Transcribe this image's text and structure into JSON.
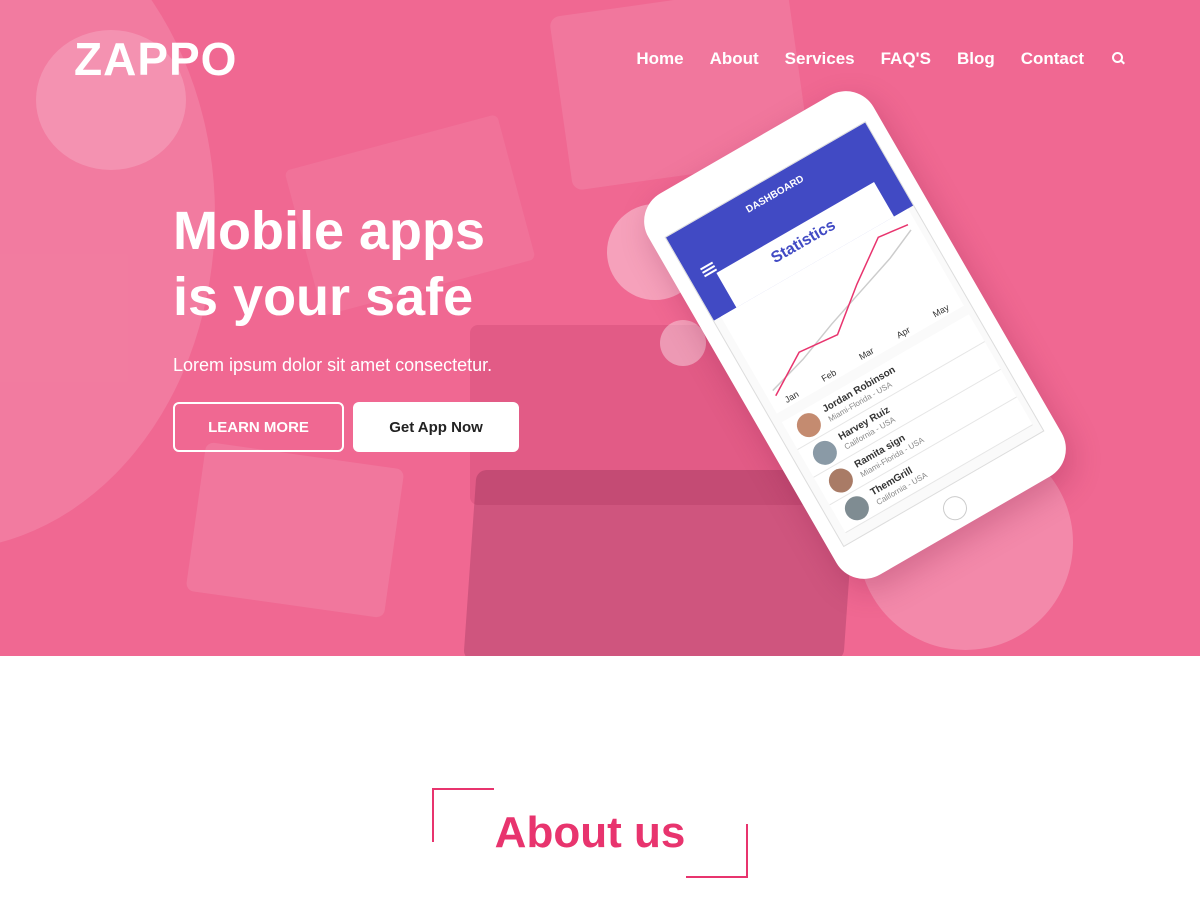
{
  "brand": {
    "logo": "ZAPPO",
    "accent": "#e8346e",
    "hero_bg": "#f06892"
  },
  "nav": {
    "items": [
      "Home",
      "About",
      "Services",
      "FAQ'S",
      "Blog",
      "Contact"
    ],
    "search_icon": "search-icon"
  },
  "hero": {
    "headline_line1": "Mobile apps",
    "headline_line2": "is your safe",
    "subhead": "Lorem ipsum dolor sit amet consectetur.",
    "btn_learn": "LEARN MORE",
    "btn_get": "Get App Now"
  },
  "phone": {
    "header": "DASHBOARD",
    "stats_title": "Statistics",
    "months": [
      "Jan",
      "Feb",
      "Mar",
      "Apr",
      "May"
    ],
    "contacts": [
      {
        "name": "Jordan Robinson",
        "location": "Miami-Florida - USA"
      },
      {
        "name": "Harvey Ruiz",
        "location": "California - USA"
      },
      {
        "name": "Ramita sign",
        "location": "Miami-Florida - USA"
      },
      {
        "name": "ThemGrill",
        "location": "California - USA"
      }
    ]
  },
  "about": {
    "title": "About us"
  }
}
